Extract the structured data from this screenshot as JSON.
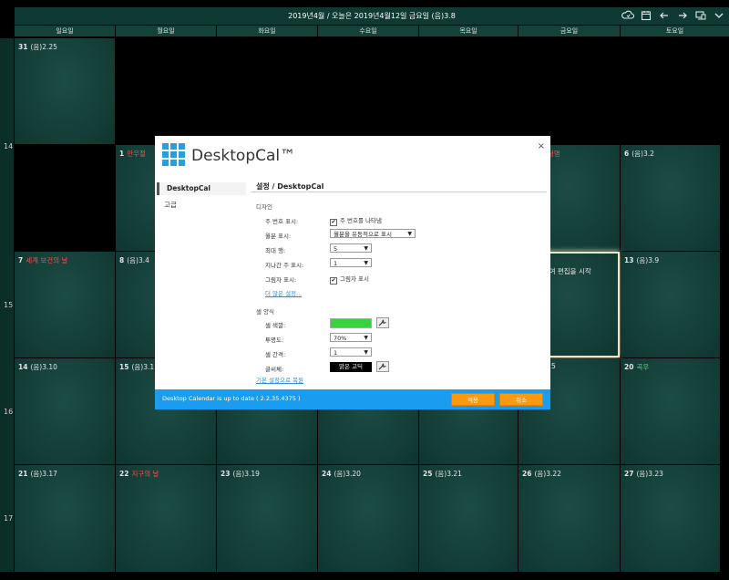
{
  "header": {
    "title": "2019년4월 / 오늘은 2019년4월12일 금요일 (음)3.8",
    "icons": [
      "cloud-sync-icon",
      "calendar-icon",
      "arrow-left-icon",
      "arrow-right-icon",
      "monitor-icon",
      "chevron-down-icon"
    ]
  },
  "weekdays": [
    "일요일",
    "월요일",
    "화요일",
    "수요일",
    "목요일",
    "금요일",
    "토요일"
  ],
  "week_numbers": [
    "14",
    "15",
    "16",
    "17"
  ],
  "calendar": {
    "row0": [
      {
        "num": "31",
        "lunar": "(음)2.25"
      }
    ],
    "row1": [
      {
        "num": "1",
        "lunar": "만우절",
        "lunar_color": "red"
      },
      {
        "num": "",
        "lunar": "식목일 / 청명",
        "lunar_color": "red"
      },
      {
        "num": "6",
        "lunar": "(음)3.2"
      }
    ],
    "row2": [
      {
        "num": "7",
        "lunar": "세계 보건의 날",
        "lunar_color": "red"
      },
      {
        "num": "8",
        "lunar": "(음)3.4"
      },
      {
        "num": "",
        "lunar": "블클릭하여 편집을 시작"
      },
      {
        "num": "13",
        "lunar": "(음)3.9"
      }
    ],
    "row3": [
      {
        "num": "14",
        "lunar": "(음)3.10"
      },
      {
        "num": "15",
        "lunar": "(음)3.11"
      },
      {
        "num": "",
        "lunar": "5"
      },
      {
        "num": "20",
        "lunar": "곡우",
        "lunar_color": "green"
      }
    ],
    "row4": [
      {
        "num": "21",
        "lunar": "(음)3.17"
      },
      {
        "num": "22",
        "lunar": "지구의 날",
        "lunar_color": "red"
      },
      {
        "num": "23",
        "lunar": "(음)3.19"
      },
      {
        "num": "24",
        "lunar": "(음)3.20"
      },
      {
        "num": "25",
        "lunar": "(음)3.21"
      },
      {
        "num": "26",
        "lunar": "(음)3.22"
      },
      {
        "num": "27",
        "lunar": "(음)3.23"
      }
    ]
  },
  "dialog": {
    "app_title": "DesktopCal™",
    "close": "×",
    "sidebar": [
      "DesktopCal",
      "고급"
    ],
    "breadcrumb": "설정 / DesktopCal",
    "design": {
      "section": "디자인",
      "week_number_label": "주 번호 표시:",
      "week_number_check": "주 번호를 나타냄",
      "month_label": "월분 표시:",
      "month_value": "월분을 유동적으로 표시",
      "max_rows_label": "최대 행:",
      "max_rows_value": "5",
      "past_weeks_label": "지나간 주 표시:",
      "past_weeks_value": "1",
      "shadow_label": "그림자 표시:",
      "shadow_check": "그림자 표시",
      "more_link": "더 많은 설정..."
    },
    "cell_style": {
      "section": "셀 양식",
      "color_label": "셀 색깔:",
      "color_value": "#39d13f",
      "opacity_label": "투명도:",
      "opacity_value": "70%",
      "spacing_label": "셀 간격:",
      "spacing_value": "1",
      "font_label": "글씨체:",
      "font_value": "맑은 고딕",
      "reset_link": "기본 설정으로 복원"
    },
    "footer": {
      "status": "Desktop Calendar is up to date ( 2.2.35.4375 )",
      "apply": "적용",
      "cancel": "취소"
    }
  }
}
